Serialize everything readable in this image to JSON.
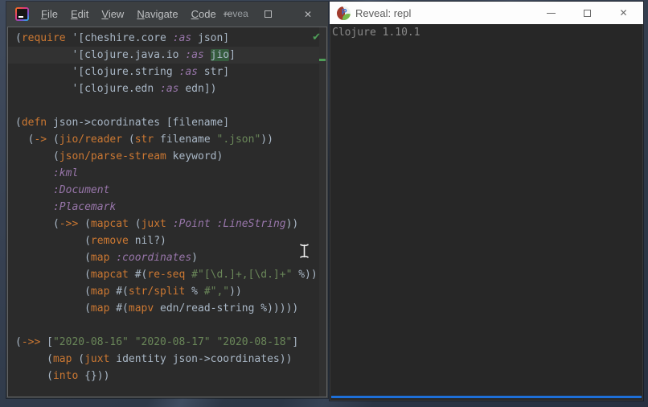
{
  "colors": {
    "titlebar_bg": "#3c3f41",
    "editor_bg": "#2b2b2b",
    "current_line": "#323232",
    "text": "#a9b7c6",
    "kw": "#cc7832",
    "key": "#9876aa",
    "str": "#6a8759",
    "hl_bg": "#355b3e",
    "check_green": "#4f9e58",
    "accent_blue": "#1d6fd8",
    "repl_text": "#8a8a8a"
  },
  "ide_window": {
    "titlebar": {
      "menus": [
        "File",
        "Edit",
        "View",
        "Navigate",
        "Code"
      ],
      "overflow_label": "revea",
      "controls": {
        "minimize": "minimize",
        "maximize": "maximize",
        "close": "✕"
      }
    },
    "editor": {
      "status_check": "✔",
      "lines": [
        {
          "t": [
            [
              "d",
              "("
            ],
            [
              "k",
              "require"
            ],
            [
              "d",
              " '[cheshire.core "
            ],
            [
              "w",
              ":as"
            ],
            [
              "d",
              " json]"
            ]
          ]
        },
        {
          "current": true,
          "t": [
            [
              "d",
              "         '[clojure.java.io "
            ],
            [
              "w",
              ":as"
            ],
            [
              "d",
              " "
            ],
            [
              "h",
              "jio"
            ],
            [
              "d",
              "]"
            ]
          ]
        },
        {
          "t": [
            [
              "d",
              "         '[clojure.string "
            ],
            [
              "w",
              ":as"
            ],
            [
              "d",
              " str]"
            ]
          ]
        },
        {
          "t": [
            [
              "d",
              "         '[clojure.edn "
            ],
            [
              "w",
              ":as"
            ],
            [
              "d",
              " edn])"
            ]
          ]
        },
        {
          "t": []
        },
        {
          "t": [
            [
              "d",
              "("
            ],
            [
              "k",
              "defn"
            ],
            [
              "d",
              " json->coordinates [filename]"
            ]
          ]
        },
        {
          "t": [
            [
              "d",
              "  ("
            ],
            [
              "k",
              "->"
            ],
            [
              "d",
              " ("
            ],
            [
              "k",
              "jio/reader"
            ],
            [
              "d",
              " ("
            ],
            [
              "k",
              "str"
            ],
            [
              "d",
              " filename "
            ],
            [
              "s",
              "\".json\""
            ],
            [
              "d",
              "))"
            ]
          ]
        },
        {
          "t": [
            [
              "d",
              "      ("
            ],
            [
              "k",
              "json/parse-stream"
            ],
            [
              "d",
              " keyword)"
            ]
          ]
        },
        {
          "t": [
            [
              "d",
              "      "
            ],
            [
              "w",
              ":kml"
            ]
          ]
        },
        {
          "t": [
            [
              "d",
              "      "
            ],
            [
              "w",
              ":Document"
            ]
          ]
        },
        {
          "t": [
            [
              "d",
              "      "
            ],
            [
              "w",
              ":Placemark"
            ]
          ]
        },
        {
          "t": [
            [
              "d",
              "      ("
            ],
            [
              "k",
              "->>"
            ],
            [
              "d",
              " ("
            ],
            [
              "k",
              "mapcat"
            ],
            [
              "d",
              " ("
            ],
            [
              "k",
              "juxt"
            ],
            [
              "d",
              " "
            ],
            [
              "w",
              ":Point"
            ],
            [
              "d",
              " "
            ],
            [
              "w",
              ":LineString"
            ],
            [
              "d",
              "))"
            ]
          ]
        },
        {
          "t": [
            [
              "d",
              "           ("
            ],
            [
              "k",
              "remove"
            ],
            [
              "d",
              " nil?)"
            ]
          ]
        },
        {
          "t": [
            [
              "d",
              "           ("
            ],
            [
              "k",
              "map"
            ],
            [
              "d",
              " "
            ],
            [
              "w",
              ":coordinates"
            ],
            [
              "d",
              ")"
            ]
          ]
        },
        {
          "t": [
            [
              "d",
              "           ("
            ],
            [
              "k",
              "mapcat"
            ],
            [
              "d",
              " #("
            ],
            [
              "k",
              "re-seq"
            ],
            [
              "d",
              " "
            ],
            [
              "s",
              "#\"[\\d.]+,[\\d.]+\""
            ],
            [
              "d",
              " %))"
            ]
          ]
        },
        {
          "t": [
            [
              "d",
              "           ("
            ],
            [
              "k",
              "map"
            ],
            [
              "d",
              " #("
            ],
            [
              "k",
              "str/split"
            ],
            [
              "d",
              " % "
            ],
            [
              "s",
              "#\",\""
            ],
            [
              "d",
              "))"
            ]
          ]
        },
        {
          "t": [
            [
              "d",
              "           ("
            ],
            [
              "k",
              "map"
            ],
            [
              "d",
              " #("
            ],
            [
              "k",
              "mapv"
            ],
            [
              "d",
              " edn/read-string %)))))"
            ]
          ]
        },
        {
          "t": []
        },
        {
          "t": [
            [
              "d",
              "("
            ],
            [
              "k",
              "->>"
            ],
            [
              "d",
              " ["
            ],
            [
              "s",
              "\"2020-08-16\""
            ],
            [
              "d",
              " "
            ],
            [
              "s",
              "\"2020-08-17\""
            ],
            [
              "d",
              " "
            ],
            [
              "s",
              "\"2020-08-18\""
            ],
            [
              "d",
              "]"
            ]
          ]
        },
        {
          "t": [
            [
              "d",
              "     ("
            ],
            [
              "k",
              "map"
            ],
            [
              "d",
              " ("
            ],
            [
              "k",
              "juxt"
            ],
            [
              "d",
              " identity json->coordinates))"
            ]
          ]
        },
        {
          "t": [
            [
              "d",
              "     ("
            ],
            [
              "k",
              "into"
            ],
            [
              "d",
              " {}))"
            ]
          ]
        }
      ]
    }
  },
  "reveal_window": {
    "titlebar": {
      "title": "Reveal: repl",
      "icon_letter": "P",
      "controls": {
        "minimize": "minimize",
        "maximize": "maximize",
        "close": "✕"
      }
    },
    "repl": {
      "output": "Clojure 1.10.1"
    }
  }
}
